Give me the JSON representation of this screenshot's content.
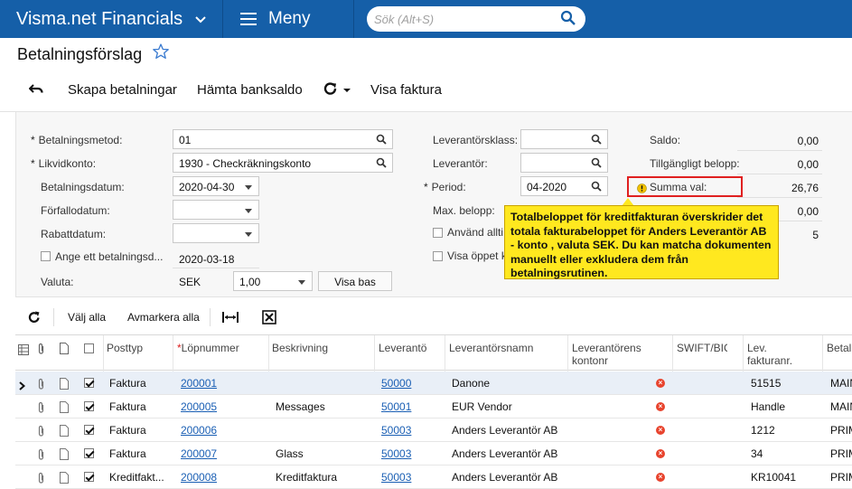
{
  "app": {
    "brand": "Visma.net Financials",
    "menu_label": "Meny",
    "search_placeholder": "Sök (Alt+S)"
  },
  "page": {
    "title": "Betalningsförslag"
  },
  "toolbar": {
    "create_payments": "Skapa betalningar",
    "fetch_balance": "Hämta banksaldo",
    "show_invoice": "Visa faktura"
  },
  "form": {
    "payment_method": {
      "label": "Betalningsmetod:",
      "value": "01"
    },
    "cash_account": {
      "label": "Likvidkonto:",
      "value": "1930 - Checkräkningskonto"
    },
    "payment_date": {
      "label": "Betalningsdatum:",
      "value": "2020-04-30"
    },
    "due_date": {
      "label": "Förfallodatum:",
      "value": ""
    },
    "discount_date": {
      "label": "Rabattdatum:",
      "value": ""
    },
    "enter_payment_date": {
      "label": "Ange ett betalningsd...",
      "value": "2020-03-18"
    },
    "currency": {
      "label": "Valuta:",
      "value": "SEK",
      "rate": "1,00",
      "base_button": "Visa bas"
    },
    "supplier_class": {
      "label": "Leverantörsklass:",
      "value": ""
    },
    "supplier": {
      "label": "Leverantör:",
      "value": ""
    },
    "period": {
      "label": "Period:",
      "value": "04-2020"
    },
    "max_amount": {
      "label": "Max. belopp:"
    },
    "use_always": {
      "label": "Använd allti"
    },
    "show_open": {
      "label": "Visa öppet k"
    },
    "balance": {
      "label": "Saldo:",
      "value": "0,00"
    },
    "available": {
      "label": "Tillgängligt belopp:",
      "value": "0,00"
    },
    "sum_selected": {
      "label": "Summa val:",
      "value": "26,76"
    },
    "extra_value_1": "0,00",
    "extra_value_2": "5"
  },
  "tooltip": {
    "text": "Totalbeloppet för kreditfakturan överskrider det totala fakturabeloppet för Anders Leverantör AB - konto , valuta SEK. Du kan matcha dokumenten manuellt eller exkludera dem från betalningsrutinen."
  },
  "grid_toolbar": {
    "select_all": "Välj alla",
    "deselect_all": "Avmarkera alla"
  },
  "table": {
    "headers": {
      "type": "Posttyp",
      "number": "Löpnummer",
      "description": "Beskrivning",
      "supplier": "Leverantö",
      "supplier_name": "Leverantörsnamn",
      "supplier_account": "Leverantörens kontonr",
      "swift": "SWIFT/BIC",
      "invoice_no": "Lev. fakturanr.",
      "payment": "Betal"
    },
    "rows": [
      {
        "type": "Faktura",
        "number": "200001",
        "description": "",
        "supplier": "50000",
        "supplier_name": "Danone",
        "invoice_no": "51515",
        "payment": "MAIN"
      },
      {
        "type": "Faktura",
        "number": "200005",
        "description": "Messages",
        "supplier": "50001",
        "supplier_name": "EUR Vendor",
        "invoice_no": "Handle",
        "payment": "MAIN"
      },
      {
        "type": "Faktura",
        "number": "200006",
        "description": "",
        "supplier": "50003",
        "supplier_name": "Anders Leverantör AB",
        "invoice_no": "1212",
        "payment": "PRIM"
      },
      {
        "type": "Faktura",
        "number": "200007",
        "description": "Glass",
        "supplier": "50003",
        "supplier_name": "Anders Leverantör AB",
        "invoice_no": "34",
        "payment": "PRIM"
      },
      {
        "type": "Kreditfakt...",
        "number": "200008",
        "description": "Kreditfaktura",
        "supplier": "50003",
        "supplier_name": "Anders Leverantör AB",
        "invoice_no": "KR10041",
        "payment": "PRIM"
      }
    ]
  }
}
